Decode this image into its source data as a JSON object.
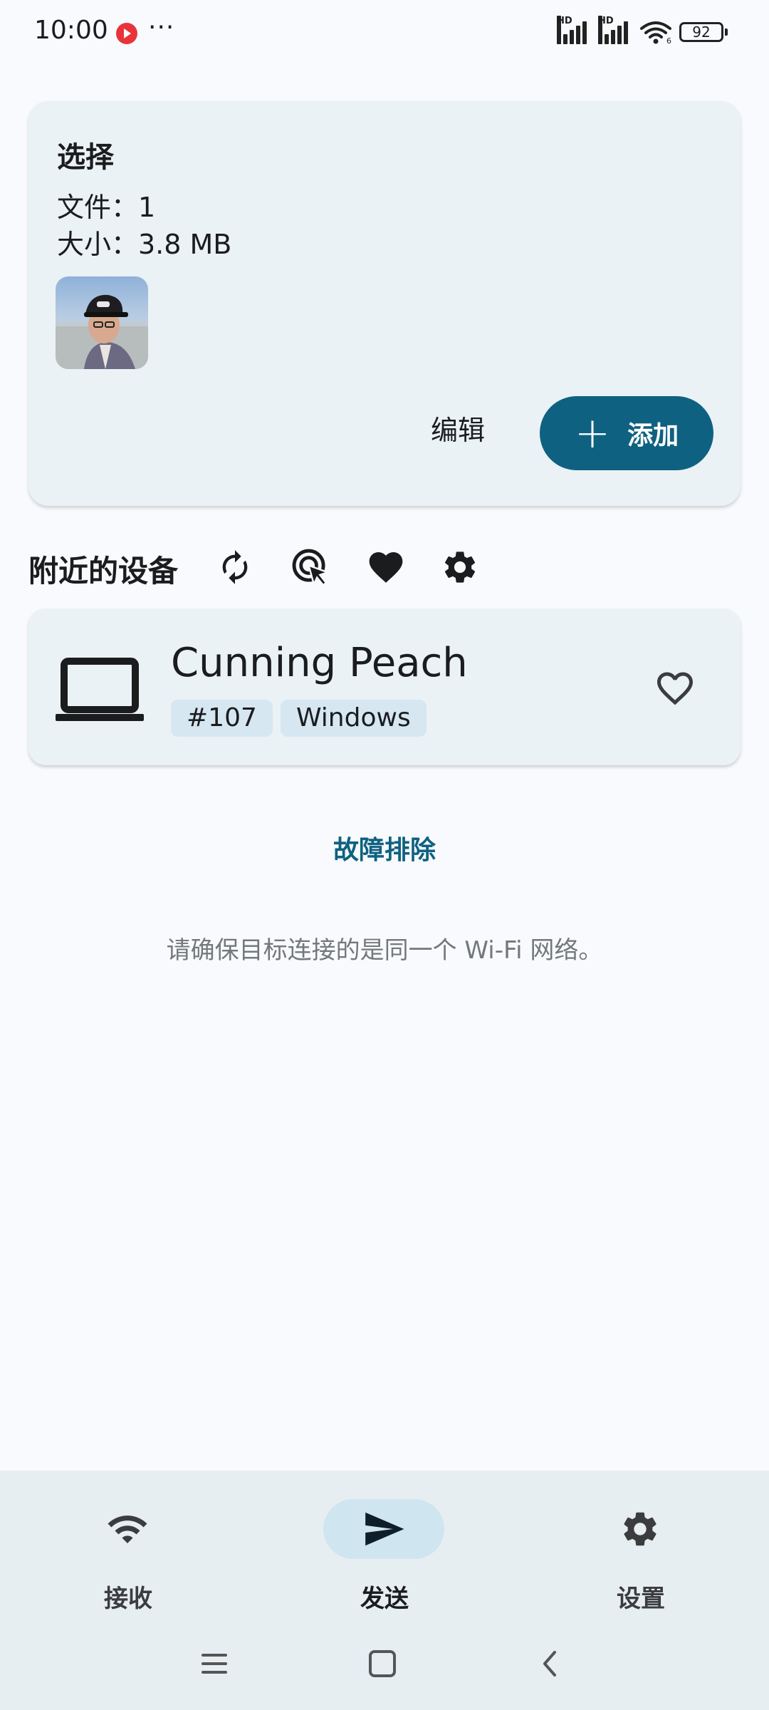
{
  "status_bar": {
    "time": "10:00",
    "more": "···",
    "hd1": "HD",
    "hd2": "HD",
    "wifi_sub": "6",
    "battery": "92"
  },
  "selection": {
    "title": "选择",
    "files_text": "文件：1",
    "size_text": "大小：3.8 MB",
    "edit_label": "编辑",
    "add_label": "添加"
  },
  "nearby": {
    "label": "附近的设备",
    "icons": [
      "refresh-icon",
      "target-cursor-icon",
      "heart-icon",
      "gear-icon"
    ]
  },
  "device": {
    "name": "Cunning Peach",
    "tags": [
      "#107",
      "Windows"
    ],
    "icon": "laptop-icon"
  },
  "troubleshoot_label": "故障排除",
  "hint_text": "请确保目标连接的是同一个 Wi-Fi 网络。",
  "bottom_nav": {
    "items": [
      {
        "label": "接收",
        "icon": "wifi-icon"
      },
      {
        "label": "发送",
        "icon": "send-icon"
      },
      {
        "label": "设置",
        "icon": "gear-icon"
      }
    ],
    "active_index": 1
  },
  "colors": {
    "accent": "#0f6181",
    "card_bg": "#eaf2f5",
    "nav_bg": "#e6eef2",
    "active_pill": "#cfe5ef"
  }
}
